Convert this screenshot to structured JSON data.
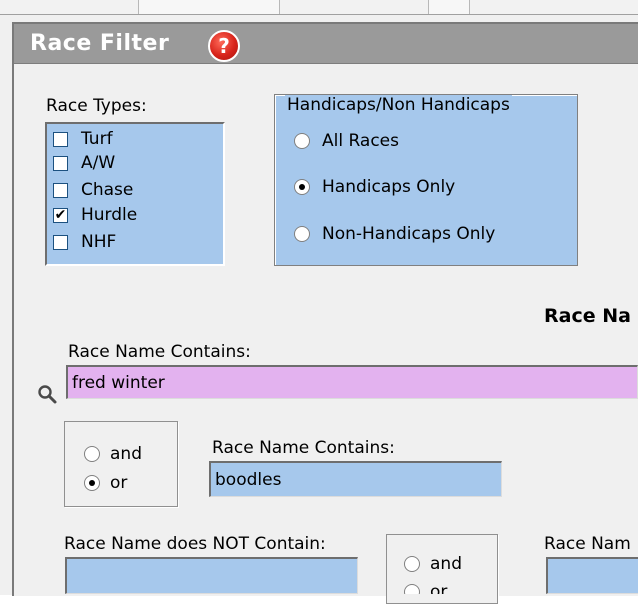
{
  "header": {
    "title": "Race Filter",
    "help_glyph": "?"
  },
  "race_types": {
    "label": "Race Types:",
    "items": [
      {
        "label": "Turf",
        "checked": false
      },
      {
        "label": "A/W",
        "checked": false
      },
      {
        "label": "Chase",
        "checked": false
      },
      {
        "label": "Hurdle",
        "checked": true
      },
      {
        "label": "NHF",
        "checked": false
      }
    ]
  },
  "handicaps": {
    "legend": "Handicaps/Non Handicaps",
    "options": [
      {
        "label": "All Races",
        "selected": false
      },
      {
        "label": "Handicaps Only",
        "selected": true
      },
      {
        "label": "Non-Handicaps Only",
        "selected": false
      }
    ]
  },
  "race_name_section": {
    "heading": "Race Na",
    "contains_label": "Race Name Contains:",
    "contains_value": "fred winter",
    "andor": {
      "and_label": "and",
      "or_label": "or",
      "selected": "or"
    },
    "contains2_label": "Race Name Contains:",
    "contains2_value": "boodles",
    "not_contains_label": "Race Name does NOT Contain:",
    "not_contains_value": "",
    "andor2": {
      "and_label": "and",
      "or_label": "or"
    },
    "cut_label": "Race Nam"
  },
  "colors": {
    "field_blue": "#a6c8ec",
    "field_pink": "#e3b2ef",
    "title_bar": "#9a9a9a",
    "help_red": "#d8241b"
  },
  "icons": {
    "search": "search-icon",
    "help": "help-icon",
    "check": "✔"
  }
}
